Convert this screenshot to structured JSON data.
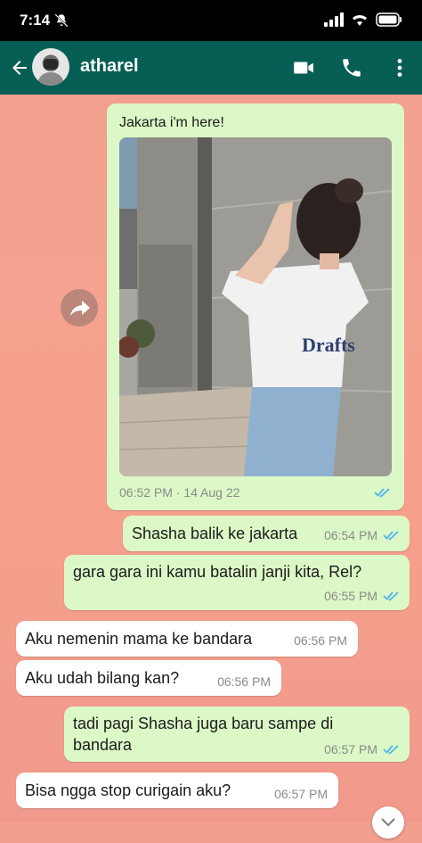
{
  "status_bar": {
    "time": "7:14"
  },
  "header": {
    "contact_name": "atharel"
  },
  "messages": [
    {
      "direction": "out",
      "caption": "Jakarta i'm here!",
      "time": "06:52 PM · 14 Aug 22"
    },
    {
      "direction": "out",
      "text": "Shasha balik ke jakarta",
      "time": "06:54 PM"
    },
    {
      "direction": "out",
      "text": "gara gara ini kamu batalin janji kita, Rel?",
      "time": "06:55 PM"
    },
    {
      "direction": "in",
      "text": "Aku nemenin mama ke bandara",
      "time": "06:56 PM"
    },
    {
      "direction": "in",
      "text": "Aku udah bilang kan?",
      "time": "06:56 PM"
    },
    {
      "direction": "out",
      "text": "tadi pagi Shasha juga baru sampe di bandara",
      "time": "06:57 PM"
    },
    {
      "direction": "in",
      "text": "Bisa ngga stop curigain aku?",
      "time": "06:57 PM"
    }
  ],
  "colors": {
    "header": "#075e54",
    "outgoing_bubble": "#dcf8c6",
    "incoming_bubble": "#ffffff",
    "read_ticks": "#4fb6ec"
  }
}
